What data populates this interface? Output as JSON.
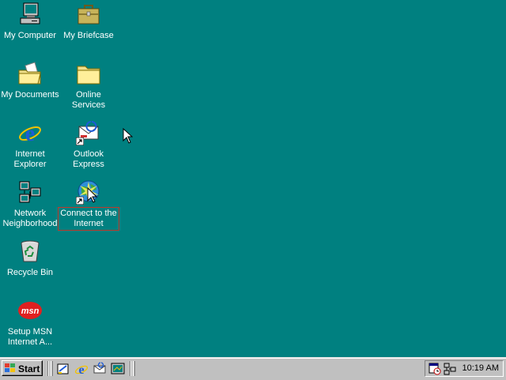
{
  "desktop": {
    "background_color": "#008080",
    "icons": [
      {
        "name": "my-computer",
        "label": "My Computer",
        "icon": "computer-icon"
      },
      {
        "name": "my-briefcase",
        "label": "My Briefcase",
        "icon": "briefcase-icon"
      },
      {
        "name": "my-documents",
        "label": "My Documents",
        "icon": "documents-folder-icon"
      },
      {
        "name": "online-services",
        "label": "Online\nServices",
        "icon": "folder-icon"
      },
      {
        "name": "internet-explorer",
        "label": "Internet\nExplorer",
        "icon": "internet-explorer-icon"
      },
      {
        "name": "outlook-express",
        "label": "Outlook\nExpress",
        "icon": "outlook-express-icon"
      },
      {
        "name": "network-neighborhood",
        "label": "Network\nNeighborhood",
        "icon": "network-icon"
      },
      {
        "name": "connect-to-internet",
        "label": "Connect to the\nInternet",
        "icon": "connect-wizard-icon",
        "selected": true
      },
      {
        "name": "recycle-bin",
        "label": "Recycle Bin",
        "icon": "recycle-bin-icon"
      },
      {
        "name": "setup-msn",
        "label": "Setup MSN\nInternet A...",
        "icon": "msn-icon"
      }
    ]
  },
  "taskbar": {
    "start_label": "Start",
    "quick_launch": [
      "show-desktop-icon",
      "internet-explorer-icon",
      "outlook-express-icon",
      "channels-icon"
    ],
    "tray_icons": [
      "scheduler-icon",
      "network-tray-icon"
    ],
    "clock": "10:19 AM"
  }
}
